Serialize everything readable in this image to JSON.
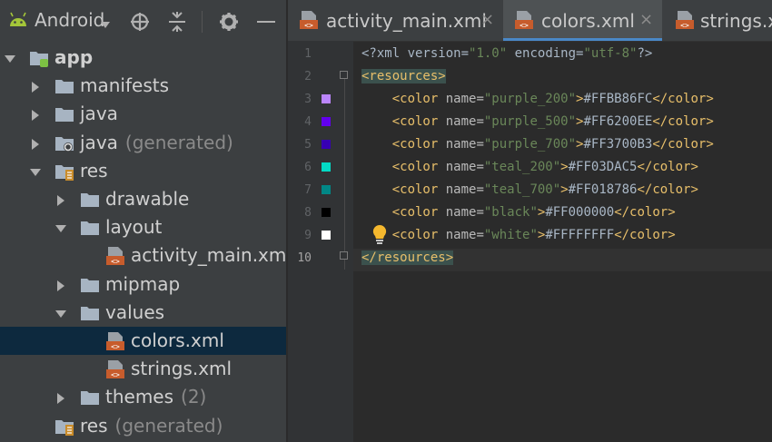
{
  "project_panel": {
    "view_mode": "Android",
    "toolbar_icons": [
      "android-icon",
      "dropdown-icon",
      "target-icon",
      "collapse-all-icon",
      "gear-icon",
      "minimize-icon"
    ],
    "tree": [
      {
        "label": "app",
        "suffix": "",
        "icon": "app-module-icon",
        "arrow": "expanded",
        "selected": false,
        "bold": true
      },
      {
        "label": "manifests",
        "suffix": "",
        "icon": "folder-icon",
        "arrow": "collapsed",
        "selected": false,
        "bold": false
      },
      {
        "label": "java",
        "suffix": "",
        "icon": "folder-icon",
        "arrow": "collapsed",
        "selected": false,
        "bold": false
      },
      {
        "label": "java",
        "suffix": "(generated)",
        "icon": "generated-folder-icon",
        "arrow": "collapsed",
        "selected": false,
        "bold": false
      },
      {
        "label": "res",
        "suffix": "",
        "icon": "res-folder-icon",
        "arrow": "expanded",
        "selected": false,
        "bold": false
      },
      {
        "label": "drawable",
        "suffix": "",
        "icon": "folder-icon",
        "arrow": "collapsed",
        "selected": false,
        "bold": false
      },
      {
        "label": "layout",
        "suffix": "",
        "icon": "folder-icon",
        "arrow": "expanded",
        "selected": false,
        "bold": false
      },
      {
        "label": "activity_main.xml",
        "suffix": "",
        "icon": "xml-file-icon",
        "arrow": "none",
        "selected": false,
        "bold": false
      },
      {
        "label": "mipmap",
        "suffix": "",
        "icon": "folder-icon",
        "arrow": "collapsed",
        "selected": false,
        "bold": false
      },
      {
        "label": "values",
        "suffix": "",
        "icon": "folder-icon",
        "arrow": "expanded",
        "selected": false,
        "bold": false
      },
      {
        "label": "colors.xml",
        "suffix": "",
        "icon": "xml-file-icon",
        "arrow": "none",
        "selected": true,
        "bold": false
      },
      {
        "label": "strings.xml",
        "suffix": "",
        "icon": "xml-file-icon",
        "arrow": "none",
        "selected": false,
        "bold": false
      },
      {
        "label": "themes",
        "suffix": "(2)",
        "icon": "folder-icon",
        "arrow": "collapsed",
        "selected": false,
        "bold": false
      },
      {
        "label": "res",
        "suffix": "(generated)",
        "icon": "res-folder-icon",
        "arrow": "none",
        "selected": false,
        "bold": false
      }
    ]
  },
  "editor": {
    "tabs": [
      {
        "label": "activity_main.xml",
        "active": false,
        "close": "×"
      },
      {
        "label": "colors.xml",
        "active": true,
        "close": "×"
      },
      {
        "label": "strings.x",
        "active": false,
        "close": ""
      }
    ],
    "line_numbers": [
      "1",
      "2",
      "3",
      "4",
      "5",
      "6",
      "7",
      "8",
      "9",
      "10"
    ],
    "current_line": "10",
    "swatch_colors": [
      "#BB86FC",
      "#6200EE",
      "#3700B3",
      "#03DAC5",
      "#018786",
      "#000000",
      "#FFFFFF"
    ],
    "code": {
      "l1_decl_open": "<?xml version=",
      "l1_version": "\"1.0\"",
      "l1_encoding_attr": " encoding=",
      "l1_encoding": "\"utf-8\"",
      "l1_decl_close": "?>",
      "resources_open": "<resources>",
      "resources_close": "</resources>",
      "color_open": "<color",
      "name_attr": " name=",
      "color_close": "</color>",
      "entries": [
        {
          "name": "\"purple_200\"",
          "value": "#FFBB86FC"
        },
        {
          "name": "\"purple_500\"",
          "value": "#FF6200EE"
        },
        {
          "name": "\"purple_700\"",
          "value": "#FF3700B3"
        },
        {
          "name": "\"teal_200\"",
          "value": "#FF03DAC5"
        },
        {
          "name": "\"teal_700\"",
          "value": "#FF018786"
        },
        {
          "name": "\"black\"",
          "value": "#FF000000"
        },
        {
          "name": "\"white\"",
          "value": "#FFFFFFFF"
        }
      ]
    },
    "gutter_icons": [
      "lightbulb-icon"
    ],
    "accent_color": "#4a88c7",
    "selection_color": "#0d293e"
  }
}
